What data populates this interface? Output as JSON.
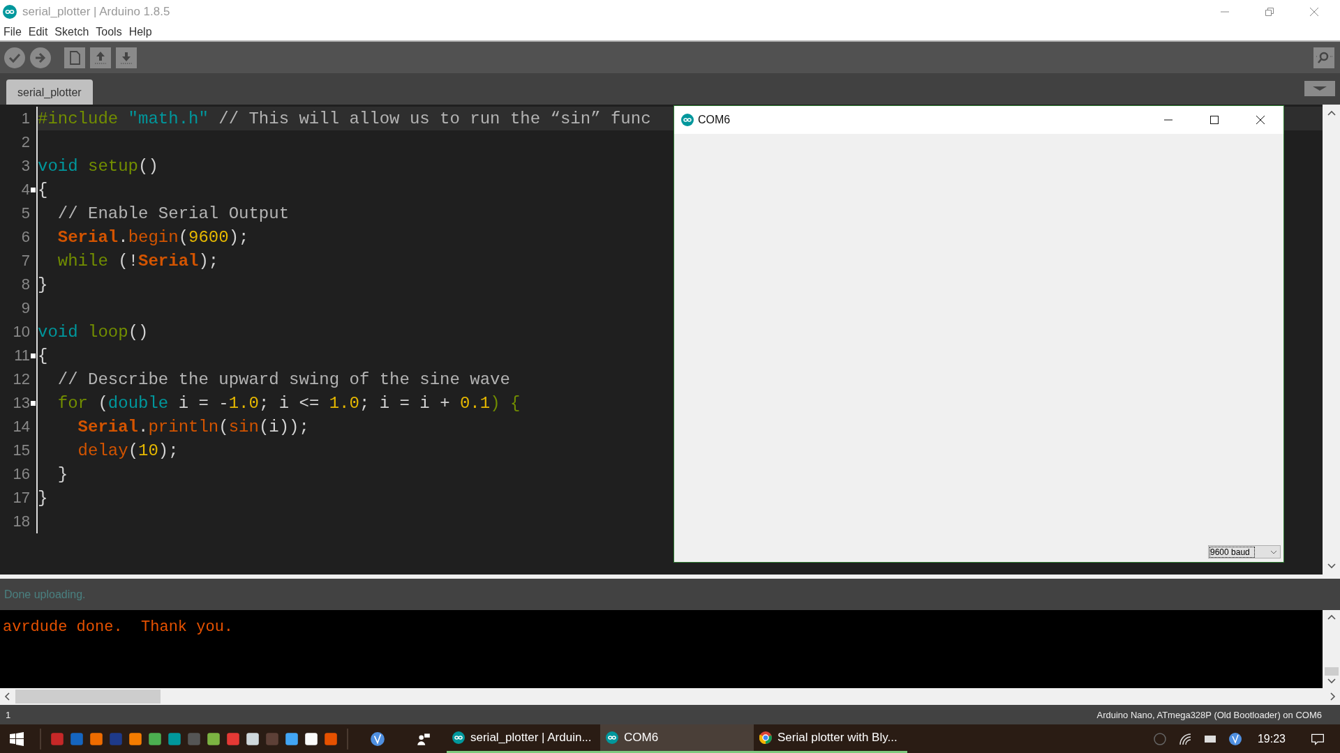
{
  "window": {
    "title": "serial_plotter | Arduino 1.8.5"
  },
  "menu": [
    "File",
    "Edit",
    "Sketch",
    "Tools",
    "Help"
  ],
  "tabs": [
    {
      "label": "serial_plotter",
      "selected": true
    }
  ],
  "editor": {
    "lines": [
      {
        "n": "1",
        "current": true,
        "fold": false,
        "tokens": [
          {
            "t": "#include",
            "kind": "structure"
          },
          {
            "t": " \"math.h\"",
            "kind": "string"
          },
          {
            "t": " // This will allow us to run the “sin” func",
            "kind": "comment"
          }
        ]
      },
      {
        "n": "2",
        "current": false,
        "fold": false
      },
      {
        "n": "3",
        "current": false,
        "fold": false,
        "tokens": [
          {
            "t": "void",
            "kind": "keyword"
          },
          {
            "t": " setup",
            "kind": "structure"
          },
          {
            "t": "()",
            "kind": "plain"
          }
        ]
      },
      {
        "n": "4",
        "current": false,
        "fold": true,
        "tokens": [
          {
            "t": "{",
            "kind": "plain"
          }
        ]
      },
      {
        "n": "5",
        "current": false,
        "fold": false,
        "tokens": [
          {
            "t": "  // Enable Serial Output",
            "kind": "comment"
          }
        ]
      },
      {
        "n": "6",
        "current": false,
        "fold": false,
        "tokens": [
          {
            "t": "  Serial",
            "kind": "class"
          },
          {
            "t": ".",
            "kind": "plain"
          },
          {
            "t": "begin",
            "kind": "method"
          },
          {
            "t": "(",
            "kind": "plain"
          },
          {
            "t": "9600",
            "kind": "number"
          },
          {
            "t": ");",
            "kind": "plain"
          }
        ]
      },
      {
        "n": "7",
        "current": false,
        "fold": false,
        "tokens": [
          {
            "t": "  while",
            "kind": "structure"
          },
          {
            "t": " (!",
            "kind": "plain"
          },
          {
            "t": "Serial",
            "kind": "class"
          },
          {
            "t": ");",
            "kind": "plain"
          }
        ]
      },
      {
        "n": "8",
        "current": false,
        "fold": false,
        "tokens": [
          {
            "t": "}",
            "kind": "plain"
          }
        ]
      },
      {
        "n": "9",
        "current": false,
        "fold": false
      },
      {
        "n": "10",
        "current": false,
        "fold": false,
        "tokens": [
          {
            "t": "void",
            "kind": "keyword"
          },
          {
            "t": " loop",
            "kind": "structure"
          },
          {
            "t": "()",
            "kind": "plain"
          }
        ]
      },
      {
        "n": "11",
        "current": false,
        "fold": true,
        "tokens": [
          {
            "t": "{",
            "kind": "plain"
          }
        ]
      },
      {
        "n": "12",
        "current": false,
        "fold": false,
        "tokens": [
          {
            "t": "  // Describe the upward swing of the sine wave",
            "kind": "comment"
          }
        ]
      },
      {
        "n": "13",
        "current": false,
        "fold": true,
        "tokens": [
          {
            "t": "  for",
            "kind": "structure"
          },
          {
            "t": " (",
            "kind": "plain"
          },
          {
            "t": "double",
            "kind": "keyword"
          },
          {
            "t": " i = -",
            "kind": "plain"
          },
          {
            "t": "1.0",
            "kind": "number"
          },
          {
            "t": "; i <= ",
            "kind": "plain"
          },
          {
            "t": "1.0",
            "kind": "number"
          },
          {
            "t": "; i = i + ",
            "kind": "plain"
          },
          {
            "t": "0.1",
            "kind": "number"
          },
          {
            "t": ") {",
            "kind": "structure"
          }
        ]
      },
      {
        "n": "14",
        "current": false,
        "fold": false,
        "tokens": [
          {
            "t": "    Serial",
            "kind": "class"
          },
          {
            "t": ".",
            "kind": "plain"
          },
          {
            "t": "println",
            "kind": "method"
          },
          {
            "t": "(",
            "kind": "plain"
          },
          {
            "t": "sin",
            "kind": "method"
          },
          {
            "t": "(i));",
            "kind": "plain"
          }
        ]
      },
      {
        "n": "15",
        "current": false,
        "fold": false,
        "tokens": [
          {
            "t": "    delay",
            "kind": "method"
          },
          {
            "t": "(",
            "kind": "plain"
          },
          {
            "t": "10",
            "kind": "number"
          },
          {
            "t": ");",
            "kind": "plain"
          }
        ]
      },
      {
        "n": "16",
        "current": false,
        "fold": false,
        "tokens": [
          {
            "t": "  }",
            "kind": "plain"
          }
        ]
      },
      {
        "n": "17",
        "current": false,
        "fold": false,
        "tokens": [
          {
            "t": "}",
            "kind": "plain"
          }
        ]
      },
      {
        "n": "18",
        "current": false,
        "fold": false
      }
    ]
  },
  "plotter": {
    "title": "COM6",
    "baud": {
      "value": "9600 baud"
    }
  },
  "status": "Done uploading.",
  "console": "avrdude done.  Thank you.",
  "status_bar": {
    "line": "1",
    "board": "Arduino Nano, ATmega328P (Old Bootloader) on COM6"
  },
  "taskbar": {
    "tasks": [
      {
        "label": "serial_plotter | Arduin...",
        "selected": false,
        "kind": "arduino"
      },
      {
        "label": "COM6",
        "selected": true,
        "kind": "arduino"
      },
      {
        "label": "Serial plotter with Bly...",
        "selected": false,
        "kind": "browser"
      }
    ],
    "time": "19:23"
  }
}
